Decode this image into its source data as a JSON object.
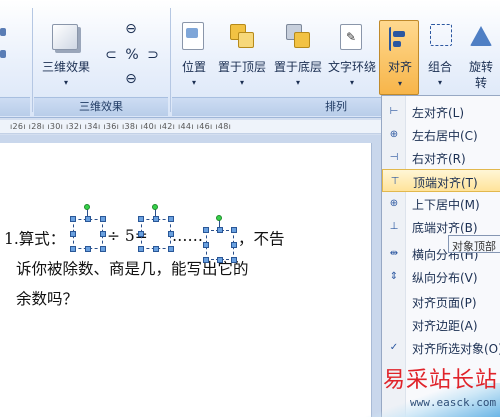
{
  "ribbon": {
    "group_3d": {
      "button_label": "三维效果",
      "caption": "三维效果"
    },
    "group_arrange": {
      "caption": "排列",
      "buttons": [
        {
          "label": "位置"
        },
        {
          "label": "置于顶层"
        },
        {
          "label": "置于底层"
        },
        {
          "label": "文字环绕"
        },
        {
          "label": "对齐"
        },
        {
          "label": "组合"
        },
        {
          "label": "旋转"
        }
      ],
      "rotate_suffix": "转"
    }
  },
  "ruler": {
    "ticks": "ı26ı  ı28ı  ı30ı  ı32ı  ı34ı  ı36ı  ı38ı  ı40ı  ı42ı  ı44ı  ı46ı  ı48ı"
  },
  "document": {
    "line1_prefix": "1.算式：",
    "line1_mid": "÷ 5=",
    "line1_dots": "……",
    "line1_suffix": "，不告",
    "line2": "诉你被除数、商是几，能写出它的",
    "line3": "余数吗？"
  },
  "menu": {
    "items": [
      {
        "label": "左对齐(L)",
        "icon": "align-left-icon",
        "glyph": "⊢"
      },
      {
        "label": "左右居中(C)",
        "icon": "align-center-icon",
        "glyph": "⊕"
      },
      {
        "label": "右对齐(R)",
        "icon": "align-right-icon",
        "glyph": "⊣"
      },
      {
        "label": "顶端对齐(T)",
        "icon": "align-top-icon",
        "glyph": "⊤"
      },
      {
        "label": "上下居中(M)",
        "icon": "align-middle-icon",
        "glyph": "⊕"
      },
      {
        "label": "底端对齐(B)",
        "icon": "align-bottom-icon",
        "glyph": "⊥"
      },
      {
        "label": "横向分布(H)",
        "icon": "distribute-horizontal-icon",
        "glyph": "⇹"
      },
      {
        "label": "纵向分布(V)",
        "icon": "distribute-vertical-icon",
        "glyph": "⇕"
      },
      {
        "label": "对齐页面(P)",
        "icon": "",
        "glyph": ""
      },
      {
        "label": "对齐边距(A)",
        "icon": "",
        "glyph": ""
      },
      {
        "label": "对齐所选对象(O)",
        "icon": "checkmark-icon",
        "glyph": "✓"
      }
    ],
    "highlighted_index": 3
  },
  "tooltip": {
    "text": "对象顶部"
  },
  "watermark": {
    "text": "易采站长站",
    "url": "www.easck.com"
  },
  "colors": {
    "accent": "#2b57a0",
    "highlight": "#ffe39a",
    "watermark": "#e0232a"
  }
}
